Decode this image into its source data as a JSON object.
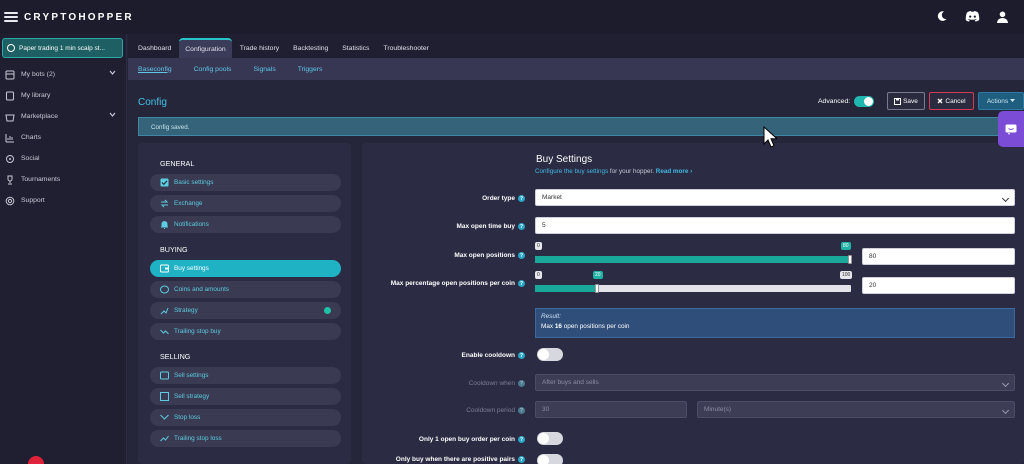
{
  "app": {
    "logo": "CRYPTOHOPPER"
  },
  "sidebar": {
    "bot_name": "Paper trading 1 min scalp st...",
    "items": [
      {
        "label": "My bots (2)",
        "icon": "bots-icon",
        "chevron": true
      },
      {
        "label": "My library",
        "icon": "library-icon",
        "chevron": false
      },
      {
        "label": "Marketplace",
        "icon": "marketplace-icon",
        "chevron": true
      },
      {
        "label": "Charts",
        "icon": "charts-icon",
        "chevron": false
      },
      {
        "label": "Social",
        "icon": "social-icon",
        "chevron": false
      },
      {
        "label": "Tournaments",
        "icon": "trophy-icon",
        "chevron": false
      },
      {
        "label": "Support",
        "icon": "support-icon",
        "chevron": false
      }
    ]
  },
  "tabs": [
    "Dashboard",
    "Configuration",
    "Trade history",
    "Backtesting",
    "Statistics",
    "Troubleshooter"
  ],
  "active_tab": "Configuration",
  "subtabs": [
    "Baseconfig",
    "Config pools",
    "Signals",
    "Triggers"
  ],
  "config": {
    "title": "Config",
    "advanced_label": "Advanced:",
    "save_label": "Save",
    "cancel_label": "Cancel",
    "actions_label": "Actions",
    "alert": "Config saved."
  },
  "menu": {
    "general_title": "GENERAL",
    "general": [
      {
        "label": "Basic settings",
        "icon": "checkbox-icon"
      },
      {
        "label": "Exchange",
        "icon": "exchange-icon"
      },
      {
        "label": "Notifications",
        "icon": "bell-icon"
      }
    ],
    "buying_title": "BUYING",
    "buying": [
      {
        "label": "Buy settings",
        "icon": "wallet-icon",
        "active": true
      },
      {
        "label": "Coins and amounts",
        "icon": "coins-icon"
      },
      {
        "label": "Strategy",
        "icon": "strategy-icon",
        "status": true
      },
      {
        "label": "Trailing stop buy",
        "icon": "trend-icon"
      }
    ],
    "selling_title": "SELLING",
    "selling": [
      {
        "label": "Sell settings",
        "icon": "sell-icon"
      },
      {
        "label": "Sell strategy",
        "icon": "strategy-icon"
      },
      {
        "label": "Stop loss",
        "icon": "stoploss-icon"
      },
      {
        "label": "Trailing stop loss",
        "icon": "trend-icon"
      }
    ]
  },
  "buy_settings": {
    "title": "Buy Settings",
    "subtitle_link": "Configure the buy settings",
    "subtitle_rest": " for your hopper.",
    "read_more": "Read more",
    "order_type_label": "Order type",
    "order_type_value": "Market",
    "max_open_time_label": "Max open time buy",
    "max_open_time_value": "5",
    "max_open_positions_label": "Max open positions",
    "max_open_positions_value": "80",
    "max_open_positions_slider_min": "0",
    "max_open_positions_slider_val": "80",
    "max_open_positions_fraction": 1.0,
    "max_pct_label": "Max percentage open positions per coin",
    "max_pct_value": "20",
    "max_pct_slider_min": "0",
    "max_pct_slider_val": "20",
    "max_pct_slider_max": "100",
    "max_pct_fraction": 0.2,
    "result_label": "Result:",
    "result_prefix": "Max ",
    "result_number": "16",
    "result_suffix": " open positions per coin",
    "enable_cooldown_label": "Enable cooldown",
    "cooldown_when_label": "Cooldown when",
    "cooldown_when_value": "After buys and sells",
    "cooldown_period_label": "Cooldown period",
    "cooldown_period_value": "30",
    "cooldown_period_unit": "Minute(s)",
    "only_one_label": "Only 1 open buy order per coin",
    "only_positive_label": "Only buy when there are positive pairs"
  }
}
